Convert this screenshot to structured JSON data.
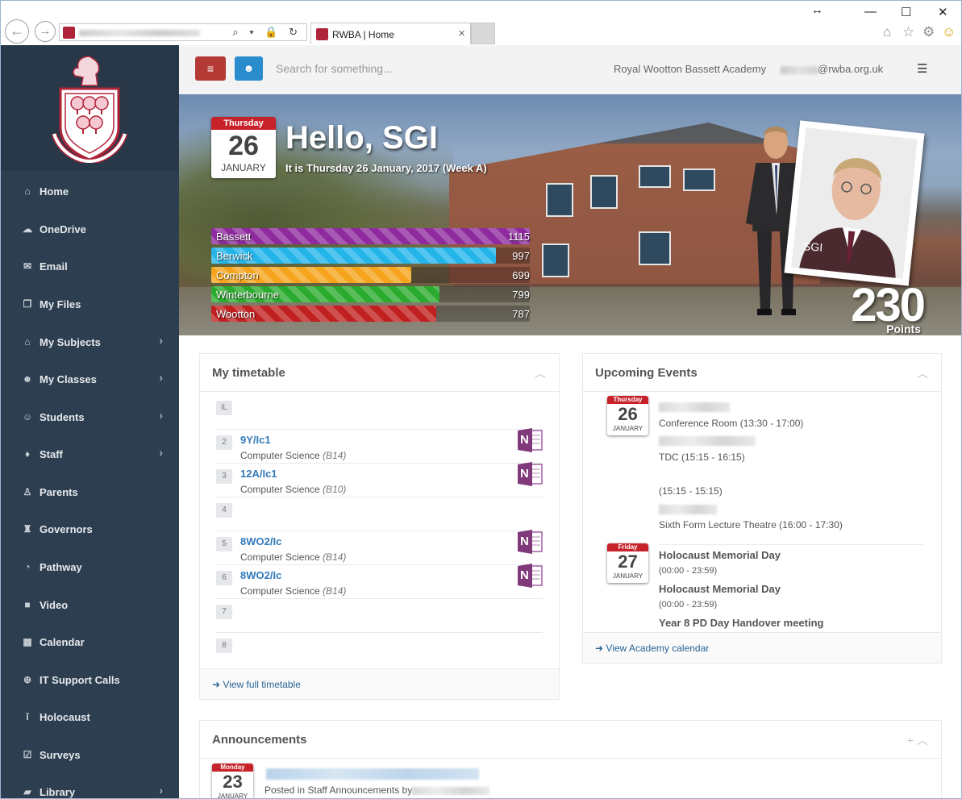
{
  "browser": {
    "tab_title": "RWBA | Home",
    "tab_close": "×",
    "back": "←",
    "forward": "→",
    "address_icons": "⌕ ▾ 🔒 ↻",
    "win_resize": "↔",
    "win_min": "—",
    "win_max": "☐",
    "win_close": "✕",
    "home": "⌂",
    "star": "☆",
    "gear": "⚙",
    "smile": "☺"
  },
  "sidebar": {
    "items": [
      {
        "label": "Home",
        "icon": "home-icon",
        "glyph": "⌂",
        "chevron": ""
      },
      {
        "label": "OneDrive",
        "icon": "cloud-icon",
        "glyph": "☁",
        "chevron": ""
      },
      {
        "label": "Email",
        "icon": "envelope-icon",
        "glyph": "✉",
        "chevron": ""
      },
      {
        "label": "My Files",
        "icon": "files-icon",
        "glyph": "❐",
        "chevron": ""
      },
      {
        "label": "My Subjects",
        "icon": "institution-icon",
        "glyph": "⌂",
        "chevron": "›"
      },
      {
        "label": "My Classes",
        "icon": "users-icon",
        "glyph": "☻",
        "chevron": "›"
      },
      {
        "label": "Students",
        "icon": "user-icon",
        "glyph": "☺",
        "chevron": "›"
      },
      {
        "label": "Staff",
        "icon": "graduation-cap-icon",
        "glyph": "♦",
        "chevron": "›"
      },
      {
        "label": "Parents",
        "icon": "parent-icon",
        "glyph": "♙",
        "chevron": ""
      },
      {
        "label": "Governors",
        "icon": "governor-icon",
        "glyph": "♜",
        "chevron": ""
      },
      {
        "label": "Pathway",
        "icon": "pie-chart-icon",
        "glyph": "◔",
        "chevron": ""
      },
      {
        "label": "Video",
        "icon": "video-camera-icon",
        "glyph": "■",
        "chevron": ""
      },
      {
        "label": "Calendar",
        "icon": "calendar-icon",
        "glyph": "▦",
        "chevron": ""
      },
      {
        "label": "IT Support Calls",
        "icon": "life-ring-icon",
        "glyph": "⊕",
        "chevron": ""
      },
      {
        "label": "Holocaust",
        "icon": "candle-icon",
        "glyph": "ǐ",
        "chevron": ""
      },
      {
        "label": "Surveys",
        "icon": "check-square-icon",
        "glyph": "☑",
        "chevron": ""
      },
      {
        "label": "Library",
        "icon": "book-icon",
        "glyph": "▰",
        "chevron": "›"
      }
    ]
  },
  "topbar": {
    "menu_glyph": "≡",
    "user_glyph": "☻",
    "search_placeholder": "Search for something...",
    "school": "Royal Wootton Bassett Academy",
    "email_domain": "@rwba.org.uk",
    "list_glyph": "☰"
  },
  "hero": {
    "cal": {
      "day": "Thursday",
      "date": "26",
      "month": "JANUARY"
    },
    "greeting": "Hello, SGI",
    "subtitle": "It is Thursday 26 January, 2017 (Week A)",
    "houses": [
      {
        "name": "Bassett",
        "points": "1115",
        "fraction": 1.0,
        "color": "#8e2a9e"
      },
      {
        "name": "Berwick",
        "points": "997",
        "fraction": 0.894,
        "color": "#23b5ea"
      },
      {
        "name": "Compton",
        "points": "699",
        "fraction": 0.627,
        "color": "#f5a41c"
      },
      {
        "name": "Winterbourne",
        "points": "799",
        "fraction": 0.717,
        "color": "#2bab2d"
      },
      {
        "name": "Wootton",
        "points": "787",
        "fraction": 0.706,
        "color": "#c0201f"
      }
    ],
    "photo_caption": "SGI",
    "points": "230",
    "points_label": "Points"
  },
  "timetable": {
    "title": "My timetable",
    "toggle": "︿",
    "header_badge": "iL",
    "slots": [
      {
        "num": "2",
        "cls": "9Y/Ic1",
        "subject": "Computer Science",
        "room": "(B14)"
      },
      {
        "num": "3",
        "cls": "12A/Ic1",
        "subject": "Computer Science",
        "room": "(B10)"
      },
      {
        "num": "4",
        "cls": "",
        "subject": "",
        "room": ""
      },
      {
        "num": "5",
        "cls": "8WO2/Ic",
        "subject": "Computer Science",
        "room": "(B14)"
      },
      {
        "num": "6",
        "cls": "8WO2/Ic",
        "subject": "Computer Science",
        "room": "(B14)"
      },
      {
        "num": "7",
        "cls": "",
        "subject": "",
        "room": ""
      },
      {
        "num": "8",
        "cls": "",
        "subject": "",
        "room": ""
      }
    ],
    "onenote": "N",
    "footer_glyph": "➜",
    "footer_link": "View full timetable"
  },
  "events": {
    "title": "Upcoming Events",
    "toggle": "︿",
    "day1": {
      "day": "Thursday",
      "date": "26",
      "month": "JANUARY"
    },
    "day1_items": [
      {
        "title": "",
        "detail": "Conference Room (13:30 - 17:00)"
      },
      {
        "title": "",
        "detail": "TDC (15:15 - 16:15)"
      },
      {
        "title": "",
        "detail": "(15:15 - 15:15)"
      },
      {
        "title": "",
        "detail": "Sixth Form Lecture Theatre (16:00 - 17:30)"
      }
    ],
    "day2": {
      "day": "Friday",
      "date": "27",
      "month": "JANUARY"
    },
    "day2_items": [
      {
        "title": "Holocaust Memorial Day",
        "detail": "(00:00 - 23:59)"
      },
      {
        "title": "Holocaust Memorial Day",
        "detail": "(00:00 - 23:59)"
      },
      {
        "title": "Year 8 PD Day Handover meeting",
        "detail": ""
      }
    ],
    "footer_glyph": "➜",
    "footer_link": "View Academy calendar"
  },
  "announcements": {
    "title": "Announcements",
    "toggle": "+ ︿",
    "cal": {
      "day": "Monday",
      "date": "23",
      "month": "JANUARY"
    },
    "posted": "Posted in Staff Announcements by"
  }
}
